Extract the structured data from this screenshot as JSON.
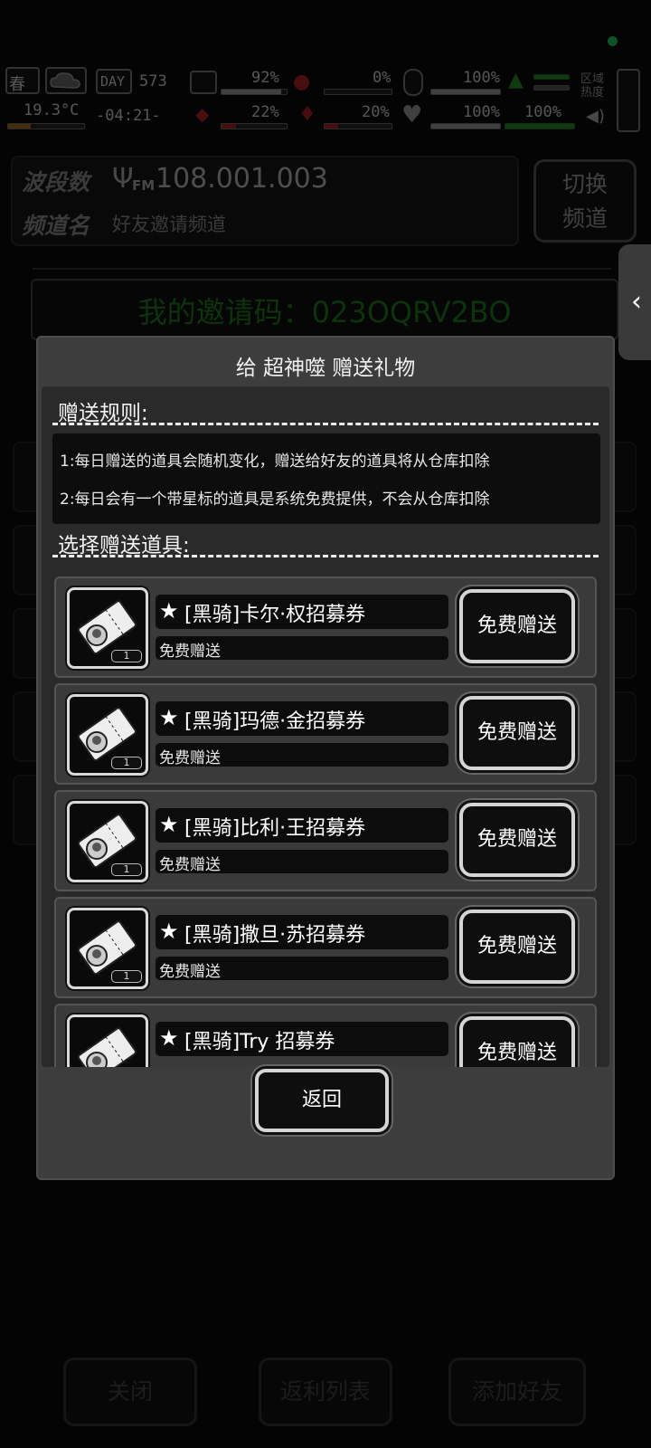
{
  "hud": {
    "season": "春",
    "temperature": "19.3°C",
    "day_label": "DAY",
    "day_value": "573",
    "time": "-04:21-",
    "stats_top": [
      "92%",
      "0%",
      "100%"
    ],
    "stats_bottom": [
      "22%",
      "20%",
      "100%",
      "100%"
    ],
    "region_heat_label": "区域热度",
    "bars": {
      "health": 0.92,
      "hunger": 0.0,
      "stamina": 1.0,
      "fatigue": 0.22,
      "thirst": 0.2,
      "mood": 1.0,
      "energy": 1.0
    }
  },
  "radio": {
    "band_label": "波段数",
    "band_value": "108.001.003",
    "fm_label": "FM",
    "channel_label": "频道名",
    "channel_value": "好友邀请频道",
    "switch_label_line1": "切换",
    "switch_label_line2": "频道"
  },
  "invite": {
    "text": "我的邀请码：023OQRV2BO"
  },
  "side_tab": {
    "icon": "chevron-left-icon",
    "glyph": "‹"
  },
  "bottom_bar": {
    "close_label": "关闭",
    "rebate_label": "返利列表",
    "add_friend_label": "添加好友"
  },
  "modal": {
    "title": "给 超神噬 赠送礼物",
    "rules_heading": "赠送规则:",
    "rules": [
      "1:每日赠送的道具会随机变化，赠送给好友的道具将从仓库扣除",
      "2:每日会有一个带星标的道具是系统免费提供，不会从仓库扣除"
    ],
    "select_heading": "选择赠送道具:",
    "items": [
      {
        "name": "[黑骑]卡尔·权招募券",
        "sub": "免费赠送",
        "count": "1",
        "button": "免费赠送"
      },
      {
        "name": "[黑骑]玛德·金招募券",
        "sub": "免费赠送",
        "count": "1",
        "button": "免费赠送"
      },
      {
        "name": "[黑骑]比利·王招募券",
        "sub": "免费赠送",
        "count": "1",
        "button": "免费赠送"
      },
      {
        "name": "[黑骑]撒旦·苏招募券",
        "sub": "免费赠送",
        "count": "1",
        "button": "免费赠送"
      },
      {
        "name": "[黑骑]Try 招募券",
        "sub": "",
        "count": "",
        "button": "免费赠送"
      }
    ],
    "back_label": "返回"
  },
  "colors": {
    "status_dot": "#22c55e",
    "invite_green": "#1f7a1f",
    "modal_bg": "#3d3d3d"
  }
}
